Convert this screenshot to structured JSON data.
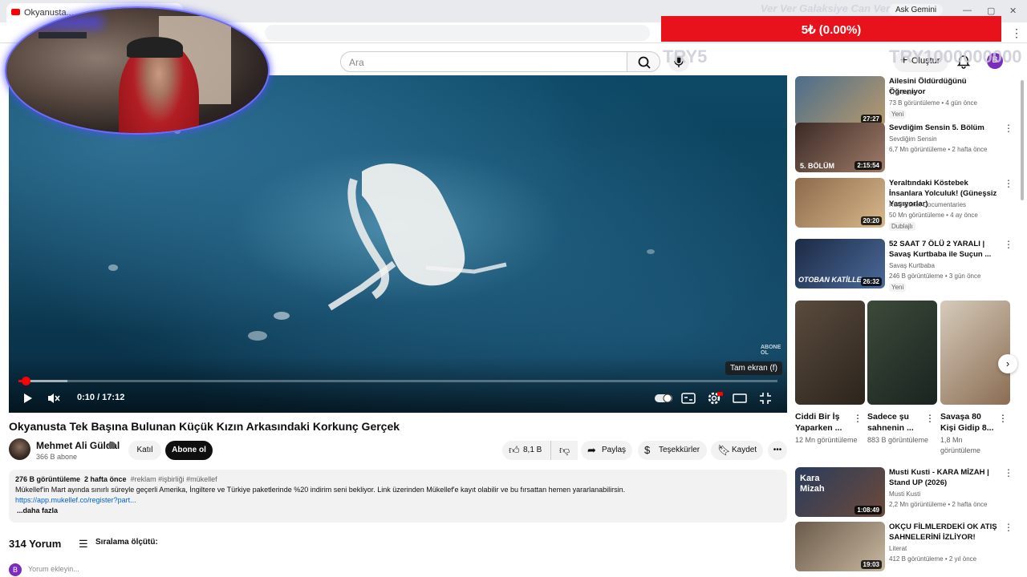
{
  "browser": {
    "tab_title": "Okyanusta...",
    "ask_gemini": "Ask Gemini",
    "menu_glyph": "⋮"
  },
  "overlay": {
    "donation_title": "Ver Ver Galaksiye Can Ver",
    "donation_amount": "5₺ (0.00%)",
    "goal_left": "TRY5",
    "goal_right": "TRY1000000000"
  },
  "header": {
    "search_placeholder": "Ara",
    "create_label": "Oluştur",
    "avatar_letter": "B"
  },
  "player": {
    "time": "0:10 / 17:12",
    "progress_fraction": 0.0097,
    "buffer_fraction": 0.065,
    "tooltip": "Tam ekran (f)",
    "watermark": "ABONE OL"
  },
  "video": {
    "title": "Okyanusta Tek Başına Bulunan Küçük Kızın Arkasındaki Korkunç Gerçek",
    "channel_name": "Mehmet Ali Güldal",
    "subscribers": "366 B abone",
    "join_label": "Katıl",
    "subscribe_label": "Abone ol",
    "likes": "8,1 B",
    "share_label": "Paylaş",
    "thanks_label": "Teşekkürler",
    "save_label": "Kaydet"
  },
  "description": {
    "views": "276 B görüntüleme",
    "date": "2 hafta önce",
    "tags": "#reklam #işbirliği #mükellef",
    "text": "Mükellef'in Mart ayında sınırlı süreyle geçerli Amerika, İngiltere ve Türkiye paketlerinde %20 indirim seni bekliyor. Link üzerinden Mükellef'e kayıt olabilir ve bu fırsattan hemen yararlanabilirsin.",
    "link": "https://app.mukellef.co/register?part...",
    "more": "...daha fazla"
  },
  "comments": {
    "count": "314 Yorum",
    "sort_label": "Sıralama ölçütü:",
    "avatar_letter": "B",
    "input_placeholder": "Yorum ekleyin..."
  },
  "recommendations": [
    {
      "title": "Ailesini Öldürdüğünü Öğreniyor",
      "channel": "The Polis",
      "meta": "73 B görüntüleme • 4 gün önce",
      "badge": "Yeni",
      "duration": "27:27",
      "colors": [
        "#4a6d8c",
        "#b99a6c"
      ]
    },
    {
      "title": "Sevdiğim Sensin 5. Bölüm",
      "channel": "Sevdiğim Sensin",
      "meta": "6,7 Mn görüntüleme • 2 hafta önce",
      "badge": "",
      "duration": "2:15:54",
      "thumb_text": "5. BÖLÜM",
      "colors": [
        "#3b2a26",
        "#a07c68"
      ]
    },
    {
      "title": "Yeraltındaki Köstebek İnsanlara Yolculuk! (Güneşsiz Yaşıyorlar)",
      "channel": "Ruhi Çenet Documentaries",
      "meta": "50 Mn görüntüleme • 4 ay önce",
      "badge": "Dublajlı",
      "duration": "20:20",
      "colors": [
        "#8c6a4c",
        "#d8b88a"
      ]
    },
    {
      "title": "52 SAAT 7 ÖLÜ 2 YARALI | Savaş Kurtbaba ile Suçun ...",
      "channel": "Savaş Kurtbaba",
      "meta": "246 B görüntüleme • 3 gün önce",
      "badge": "Yeni",
      "duration": "26:32",
      "thumb_text": "OTOBAN KATİLLE",
      "colors": [
        "#1c2a44",
        "#4a6a9a"
      ]
    }
  ],
  "shorts": [
    {
      "title": "Ciddi Bir İş Yaparken ...",
      "views": "12 Mn görüntüleme",
      "colors": [
        "#5a4c3e",
        "#2c241c"
      ]
    },
    {
      "title": "Sadece şu sahnenin ...",
      "views": "883 B görüntüleme",
      "colors": [
        "#3c4a3a",
        "#1a2420"
      ]
    },
    {
      "title": "Savaşa 80 Kişi Gidip 8...",
      "views": "1,8 Mn görüntüleme",
      "colors": [
        "#d6cbbb",
        "#8a6c52"
      ]
    }
  ],
  "recommendations_2": [
    {
      "title": "Musti Kusti - KARA MİZAH | Stand UP (2026)",
      "channel": "Musti Kusti",
      "meta": "2,2 Mn görüntüleme • 2 hafta önce",
      "duration": "1:08:49",
      "thumb_text": "Kara Mizah",
      "colors": [
        "#2a3c5c",
        "#6c4a3a"
      ]
    },
    {
      "title": "OKÇU FİLMLERDEKİ OK ATIŞ SAHNELERİNİ İZLİYOR!",
      "channel": "Literat",
      "meta": "412 B görüntüleme • 2 yıl önce",
      "duration": "19:03",
      "colors": [
        "#6a5a4a",
        "#c8b8a0"
      ]
    }
  ]
}
